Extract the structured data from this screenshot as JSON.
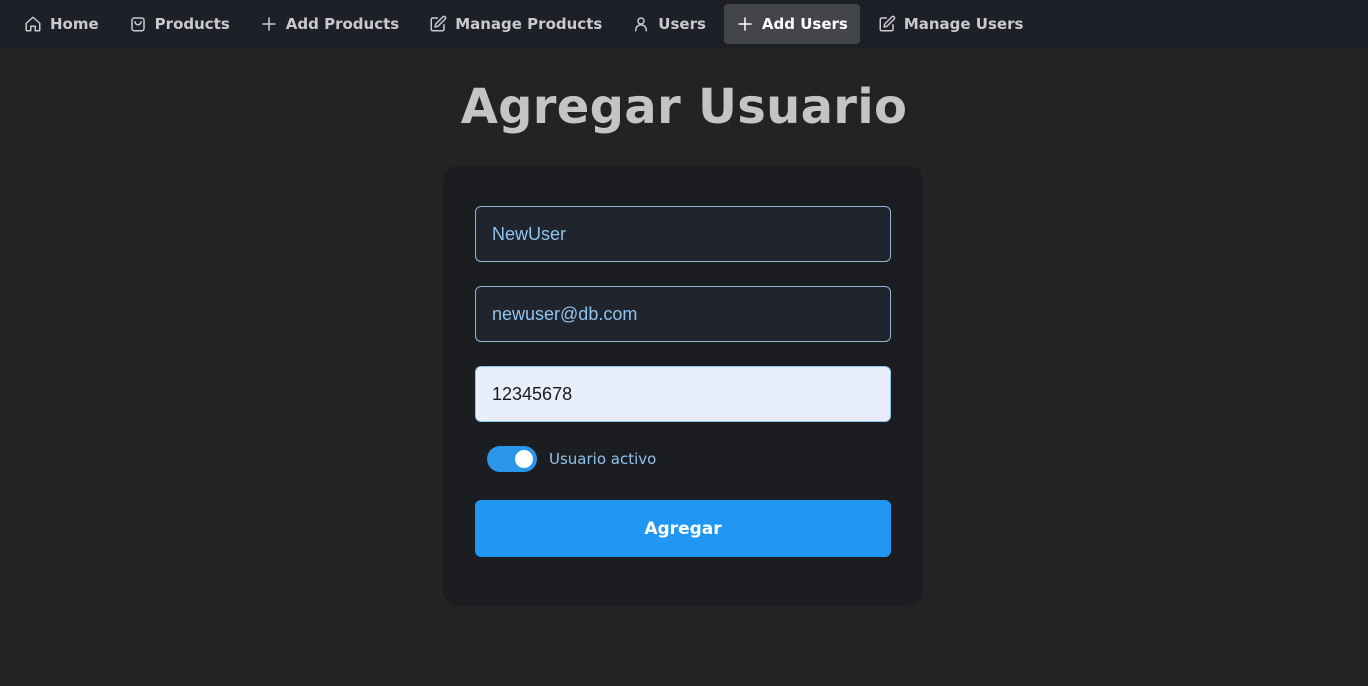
{
  "nav": {
    "items": [
      {
        "label": "Home",
        "icon": "home-icon"
      },
      {
        "label": "Products",
        "icon": "shopping-bag-icon"
      },
      {
        "label": "Add Products",
        "icon": "plus-icon"
      },
      {
        "label": "Manage Products",
        "icon": "edit-icon"
      },
      {
        "label": "Users",
        "icon": "user-icon"
      },
      {
        "label": "Add Users",
        "icon": "plus-icon",
        "active": true
      },
      {
        "label": "Manage Users",
        "icon": "edit-icon"
      }
    ]
  },
  "page": {
    "title": "Agregar Usuario"
  },
  "form": {
    "username_value": "NewUser",
    "email_value": "newuser@db.com",
    "password_value": "12345678",
    "active_toggle_on": true,
    "active_label": "Usuario activo",
    "submit_label": "Agregar"
  },
  "colors": {
    "accent": "#2196f3",
    "navbar_bg": "#1d2027",
    "page_bg": "#232323",
    "card_bg": "#1c1d21"
  }
}
